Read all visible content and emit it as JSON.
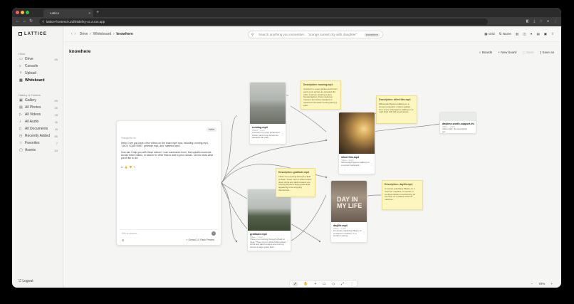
{
  "browser": {
    "tab_title": "Lattice",
    "tab_close": "×",
    "new_tab": "+",
    "url": "lattice-frontend-uzdhhbbrfxy-uc.a.run.app",
    "nav_back": "←",
    "nav_forward": "→",
    "nav_reload": "↻",
    "dots_colors": [
      "#ff5f57",
      "#febc2e",
      "#28c840"
    ]
  },
  "sidebar": {
    "brand": "LATTICE",
    "section_drive": "Drive",
    "drive_items": [
      {
        "label": "Drive",
        "icon": "drive-icon",
        "count": "85"
      },
      {
        "label": "Console",
        "icon": "console-icon",
        "count": ""
      },
      {
        "label": "Upload",
        "icon": "upload-icon",
        "count": ""
      },
      {
        "label": "Whiteboard",
        "icon": "whiteboard-icon",
        "count": ""
      }
    ],
    "section_gallery": "Gallery & Folders",
    "gallery_items": [
      {
        "label": "Gallery",
        "icon": "gallery-icon",
        "count": "85"
      },
      {
        "label": "All Photos",
        "icon": "photos-icon",
        "count": "26"
      },
      {
        "label": "All Videos",
        "icon": "videos-icon",
        "count": "28"
      },
      {
        "label": "All Audio",
        "icon": "audio-icon",
        "count": "16"
      },
      {
        "label": "All Documents",
        "icon": "documents-icon",
        "count": "15"
      },
      {
        "label": "Recently Added",
        "icon": "recent-icon",
        "count": "85"
      },
      {
        "label": "Favorites",
        "icon": "star-icon",
        "count": "7"
      },
      {
        "label": "Assets",
        "icon": "assets-icon",
        "count": "83"
      }
    ],
    "logout": "Logout"
  },
  "topbar": {
    "crumb_drive": "Drive",
    "crumb_whiteboard": "Whiteboard",
    "crumb_current": "knowhere",
    "search_placeholder": "Search anything you remember... \"orange sunset city with daughter\"",
    "search_scope": "knowhere",
    "grid_label": "Grid",
    "name_label": "Name"
  },
  "page": {
    "title": "knowhere",
    "boards": "Boards",
    "new_board": "New board",
    "save": "Save",
    "save_as": "Save as"
  },
  "chat": {
    "hello": "hello",
    "thought": "Thought for 4s",
    "msg1": "Hello! I see you have a few videos on the board right now, including: running.mp4, \"JACK YOUR BIKE\", gelimide.mp4, and \"skeleton.mp4\".",
    "msg2": "How can I help you with these videos? I can summarize them, find specific moments across these videos, or search for other files to add to your canvas. Let me know what you'd like to do!",
    "input_placeholder": "Ask or search...",
    "model": "Gemini 3.0 Flash Preview"
  },
  "nodes": [
    {
      "title": "running.mp4",
      "meta": "Video · 1 min",
      "desc": "A person in a grey jacket and brown pants runs across an elevated dirt path..."
    },
    {
      "title": "gratitude.mp4",
      "meta": "Video · 1 min",
      "desc": "Three men running through a field at dusk. Three men in white button-down shirts and dark trousers are running across a large grass field..."
    },
    {
      "title": "silent film.mp4",
      "meta": "Video · 1 min",
      "desc": "Silhouetted figures walking on a sunset boulevard..."
    },
    {
      "title": "daylife.mp4",
      "meta": "Video · 1 min",
      "desc": "A woman practicing Pilates on a reformer machine, in a workout setting..."
    },
    {
      "title": "daytime-worth-support-this.mp4",
      "meta": "Video · 1 min",
      "desc": "Video card. No description yet..."
    }
  ],
  "notes": [
    {
      "head": "Description: running.mp4",
      "body": "A person in a grey jacket and brown pants runs across an elevated dirt path. A person wearing a grey hooded jacket, brown wide-leg trousers and white sneakers is captured mid-stride running along a path..."
    },
    {
      "head": "Description: silent film.mp4",
      "body": "Silhouetted figures walking on a sunset boulevard. A warm golden-hour scene with figures walking on a road lined with tall street lamps..."
    },
    {
      "head": "Description: gratitude.mp4",
      "body": "Three men running through a field at dusk. Three men in white button-down shirts and dark trousers are running across a large grass field, appearing to be enjoying themselves..."
    },
    {
      "head": "Description: daylife.mp4",
      "body": "A woman practicing Pilates on a reformer machine. A woman in workout clothes is performing an exercise on a pilates reformer machine..."
    }
  ],
  "zoom": {
    "out": "−",
    "value": "70%",
    "in": "+"
  },
  "colors": {
    "accent": "#3b82f6",
    "note_bg": "#fdf6bf"
  }
}
